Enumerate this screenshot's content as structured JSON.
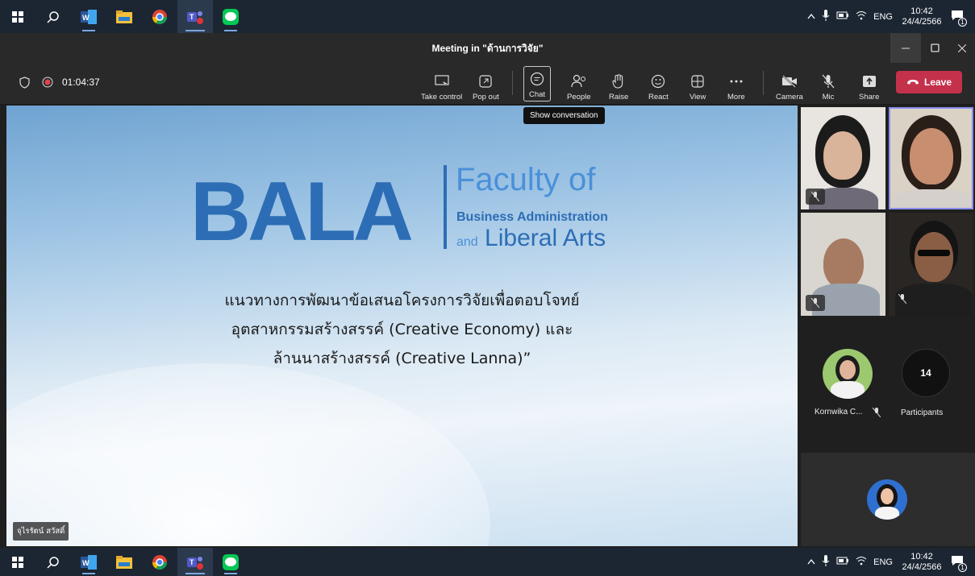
{
  "taskbar": {
    "apps": [
      {
        "icon": "windows-start-icon"
      },
      {
        "icon": "search-icon"
      },
      {
        "icon": "word-icon"
      },
      {
        "icon": "file-explorer-icon"
      },
      {
        "icon": "chrome-icon"
      },
      {
        "icon": "teams-icon"
      },
      {
        "icon": "line-icon"
      }
    ],
    "language": "ENG",
    "time": "10:42",
    "date": "24/4/2566",
    "notification_count": "1"
  },
  "window": {
    "title": "Meeting in \"ด้านการวิจัย\""
  },
  "meeting": {
    "elapsed": "01:04:37",
    "toolbar": {
      "take_control": "Take control",
      "pop_out": "Pop out",
      "chat": "Chat",
      "people": "People",
      "raise": "Raise",
      "react": "React",
      "view": "View",
      "more": "More",
      "camera": "Camera",
      "mic": "Mic",
      "share": "Share",
      "leave": "Leave"
    },
    "tooltip": "Show conversation"
  },
  "slide": {
    "logo_main": "BALA",
    "logo_line1": "Faculty of",
    "logo_line2": "Business Administration",
    "logo_line3_small": "and",
    "logo_line3": "Liberal Arts",
    "text_line1": "แนวทางการพัฒนาข้อเสนอโครงการวิจัยเพื่อตอบโจทย์",
    "text_line2": "อุตสาหกรรมสร้างสรรค์ (Creative Economy) และ",
    "text_line3": "ล้านนาสร้างสรรค์ (Creative Lanna)”",
    "presenter": "จุไรรัตน์ สวัสดิ์"
  },
  "participants": {
    "roster_name": "Kornwika C...",
    "count": "14",
    "count_label": "Participants"
  },
  "colors": {
    "leave": "#c4314b",
    "speaker_border": "#8a8ef0",
    "brand_blue": "#2c6db5"
  }
}
